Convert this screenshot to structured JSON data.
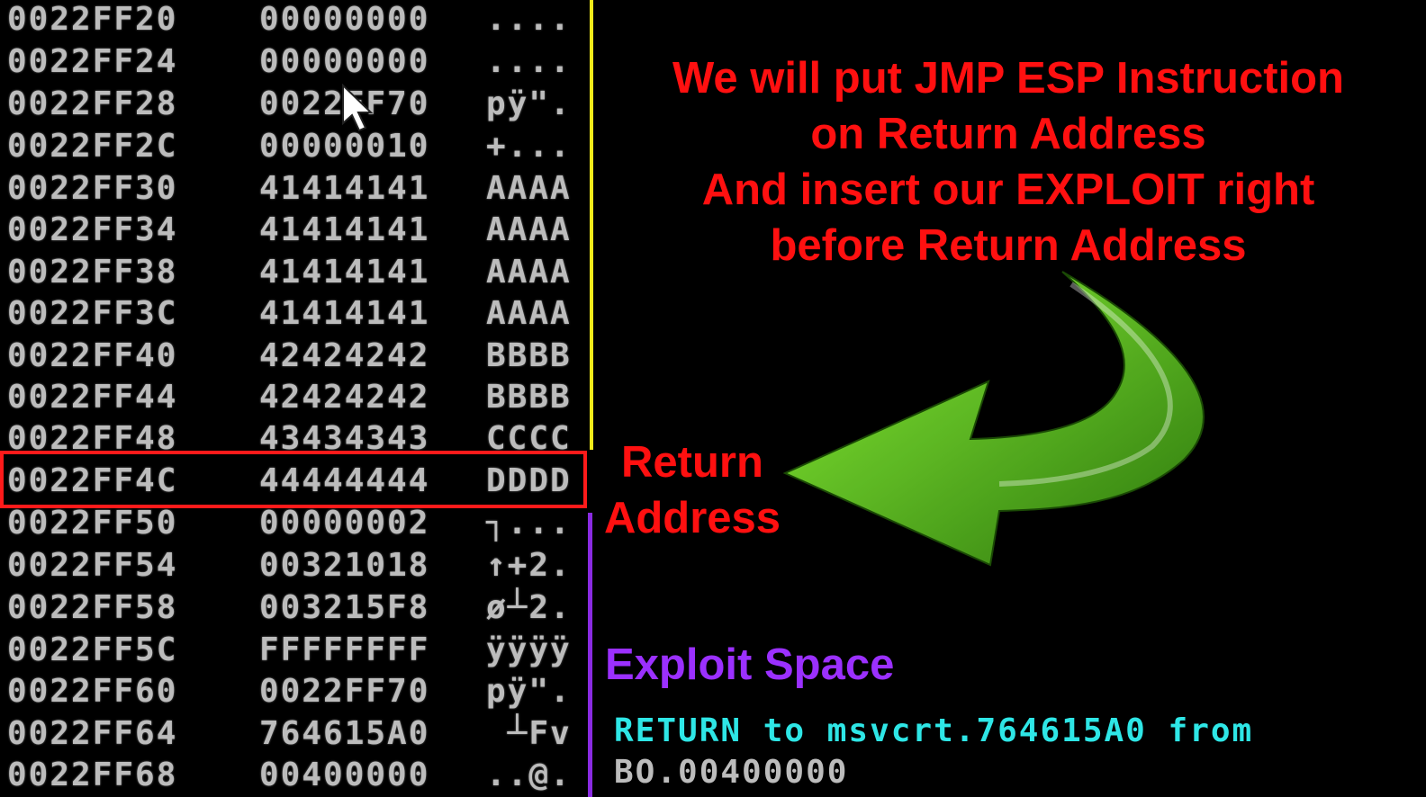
{
  "stack": [
    {
      "addr": "0022FF20",
      "value": "00000000",
      "ascii": "...."
    },
    {
      "addr": "0022FF24",
      "value": "00000000",
      "ascii": "...."
    },
    {
      "addr": "0022FF28",
      "value": "0022FF70",
      "ascii": "pÿ\"."
    },
    {
      "addr": "0022FF2C",
      "value": "00000010",
      "ascii": "+..."
    },
    {
      "addr": "0022FF30",
      "value": "41414141",
      "ascii": "AAAA"
    },
    {
      "addr": "0022FF34",
      "value": "41414141",
      "ascii": "AAAA"
    },
    {
      "addr": "0022FF38",
      "value": "41414141",
      "ascii": "AAAA"
    },
    {
      "addr": "0022FF3C",
      "value": "41414141",
      "ascii": "AAAA"
    },
    {
      "addr": "0022FF40",
      "value": "42424242",
      "ascii": "BBBB"
    },
    {
      "addr": "0022FF44",
      "value": "42424242",
      "ascii": "BBBB"
    },
    {
      "addr": "0022FF48",
      "value": "43434343",
      "ascii": "CCCC"
    },
    {
      "addr": "0022FF4C",
      "value": "44444444",
      "ascii": "DDDD"
    },
    {
      "addr": "0022FF50",
      "value": "00000002",
      "ascii": "┐..."
    },
    {
      "addr": "0022FF54",
      "value": "00321018",
      "ascii": "↑+2."
    },
    {
      "addr": "0022FF58",
      "value": "003215F8",
      "ascii": "ø┴2."
    },
    {
      "addr": "0022FF5C",
      "value": "FFFFFFFF",
      "ascii": "ÿÿÿÿ"
    },
    {
      "addr": "0022FF60",
      "value": "0022FF70",
      "ascii": "pÿ\"."
    },
    {
      "addr": "0022FF64",
      "value": "764615A0",
      "ascii": " ┴Fv"
    },
    {
      "addr": "0022FF68",
      "value": "00400000",
      "ascii": "..@."
    }
  ],
  "annotation": {
    "headline_lines": [
      "We will put JMP ESP Instruction",
      "on Return Address",
      "And insert our EXPLOIT right",
      "before  Return Address"
    ],
    "return_label_lines": [
      "Return",
      "Address"
    ],
    "exploit_label": "Exploit Space"
  },
  "disasm": {
    "return_comment": "RETURN to msvcrt.764615A0 from",
    "bo_line": "BO.00400000"
  },
  "colors": {
    "annotation_red": "#ff1010",
    "exploit_purple": "#9b30ff",
    "separator_yellow": "#f2ea1a",
    "separator_purple": "#8a2be2",
    "comment_cyan": "#2ee6e6",
    "arrow_green": "#4caf1a"
  },
  "icons": [
    "mouse-cursor-icon",
    "curved-arrow-icon"
  ]
}
